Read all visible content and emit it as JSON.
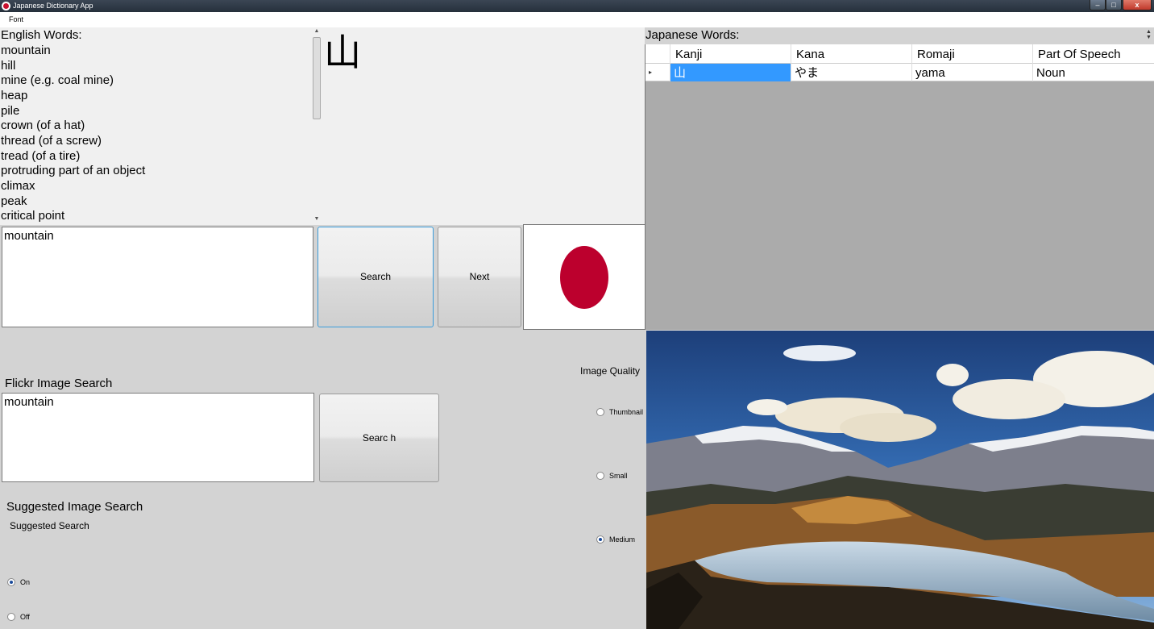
{
  "window": {
    "title": "Japanese Dictionary App",
    "min_glyph": "–",
    "max_glyph": "□",
    "close_glyph": "x"
  },
  "menu": {
    "font": "Font"
  },
  "english": {
    "label": "English Words:",
    "words": [
      "mountain",
      "hill",
      "mine (e.g. coal mine)",
      "heap",
      "pile",
      "crown (of a hat)",
      "thread (of a screw)",
      "tread (of a tire)",
      "protruding part of an object",
      "climax",
      "peak",
      "critical point"
    ]
  },
  "kanji_display": "山",
  "japanese": {
    "label": "Japanese Words:",
    "columns": [
      "Kanji",
      "Kana",
      "Romaji",
      "Part Of Speech"
    ],
    "rows": [
      {
        "kanji": "山",
        "kana": "やま",
        "romaji": "yama",
        "pos": "Noun"
      }
    ]
  },
  "search": {
    "input_value": "mountain",
    "search_label": "Search",
    "next_label": "Next"
  },
  "flickr": {
    "label": "Flickr Image Search",
    "input_value": "mountain",
    "button_label": "Searc h"
  },
  "image_quality": {
    "label": "Image Quality",
    "options": [
      "Thumbnail",
      "Small",
      "Medium"
    ],
    "selected": "Medium"
  },
  "suggested": {
    "label": "Suggested Image Search",
    "sublabel": "Suggested Search",
    "options": [
      "On",
      "Off"
    ],
    "selected": "On"
  },
  "colors": {
    "flag_red": "#bc002d",
    "selection_blue": "#3399ff",
    "panel_bg": "#f0f0f0",
    "form_bg": "#d3d3d3"
  }
}
